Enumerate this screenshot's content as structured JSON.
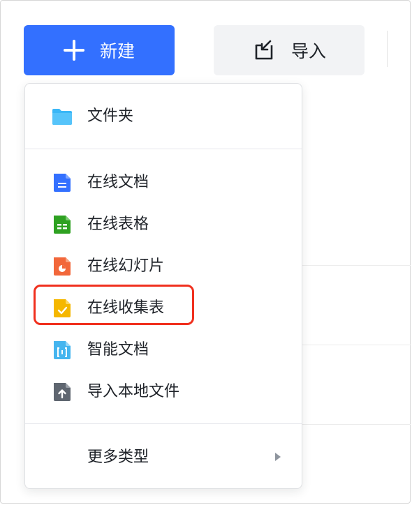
{
  "toolbar": {
    "new_label": "新建",
    "import_label": "导入"
  },
  "menu": {
    "items": [
      {
        "id": "folder",
        "label": "文件夹",
        "icon": "folder-icon",
        "color": "#3ab7f7"
      },
      {
        "id": "doc",
        "label": "在线文档",
        "icon": "doc-icon",
        "color": "#3370ff"
      },
      {
        "id": "sheet",
        "label": "在线表格",
        "icon": "sheet-icon",
        "color": "#2ea121"
      },
      {
        "id": "slides",
        "label": "在线幻灯片",
        "icon": "slides-icon",
        "color": "#f2673a"
      },
      {
        "id": "form",
        "label": "在线收集表",
        "icon": "form-icon",
        "color": "#f5b700"
      },
      {
        "id": "smartdoc",
        "label": "智能文档",
        "icon": "smart-doc-icon",
        "color": "#45b5ef"
      },
      {
        "id": "import",
        "label": "导入本地文件",
        "icon": "upload-file-icon",
        "color": "#5f6670"
      }
    ],
    "more_label": "更多类型"
  },
  "colors": {
    "primary": "#3370ff",
    "highlight": "#f0301e"
  }
}
